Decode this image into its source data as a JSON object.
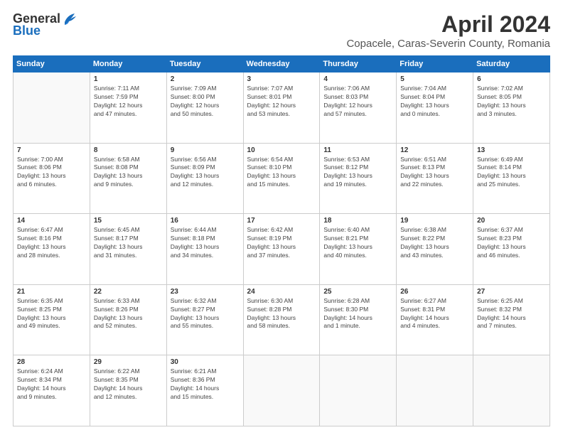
{
  "logo": {
    "text_general": "General",
    "text_blue": "Blue"
  },
  "title": "April 2024",
  "subtitle": "Copacele, Caras-Severin County, Romania",
  "calendar": {
    "headers": [
      "Sunday",
      "Monday",
      "Tuesday",
      "Wednesday",
      "Thursday",
      "Friday",
      "Saturday"
    ],
    "weeks": [
      [
        {
          "day": "",
          "info": ""
        },
        {
          "day": "1",
          "info": "Sunrise: 7:11 AM\nSunset: 7:59 PM\nDaylight: 12 hours\nand 47 minutes."
        },
        {
          "day": "2",
          "info": "Sunrise: 7:09 AM\nSunset: 8:00 PM\nDaylight: 12 hours\nand 50 minutes."
        },
        {
          "day": "3",
          "info": "Sunrise: 7:07 AM\nSunset: 8:01 PM\nDaylight: 12 hours\nand 53 minutes."
        },
        {
          "day": "4",
          "info": "Sunrise: 7:06 AM\nSunset: 8:03 PM\nDaylight: 12 hours\nand 57 minutes."
        },
        {
          "day": "5",
          "info": "Sunrise: 7:04 AM\nSunset: 8:04 PM\nDaylight: 13 hours\nand 0 minutes."
        },
        {
          "day": "6",
          "info": "Sunrise: 7:02 AM\nSunset: 8:05 PM\nDaylight: 13 hours\nand 3 minutes."
        }
      ],
      [
        {
          "day": "7",
          "info": "Sunrise: 7:00 AM\nSunset: 8:06 PM\nDaylight: 13 hours\nand 6 minutes."
        },
        {
          "day": "8",
          "info": "Sunrise: 6:58 AM\nSunset: 8:08 PM\nDaylight: 13 hours\nand 9 minutes."
        },
        {
          "day": "9",
          "info": "Sunrise: 6:56 AM\nSunset: 8:09 PM\nDaylight: 13 hours\nand 12 minutes."
        },
        {
          "day": "10",
          "info": "Sunrise: 6:54 AM\nSunset: 8:10 PM\nDaylight: 13 hours\nand 15 minutes."
        },
        {
          "day": "11",
          "info": "Sunrise: 6:53 AM\nSunset: 8:12 PM\nDaylight: 13 hours\nand 19 minutes."
        },
        {
          "day": "12",
          "info": "Sunrise: 6:51 AM\nSunset: 8:13 PM\nDaylight: 13 hours\nand 22 minutes."
        },
        {
          "day": "13",
          "info": "Sunrise: 6:49 AM\nSunset: 8:14 PM\nDaylight: 13 hours\nand 25 minutes."
        }
      ],
      [
        {
          "day": "14",
          "info": "Sunrise: 6:47 AM\nSunset: 8:16 PM\nDaylight: 13 hours\nand 28 minutes."
        },
        {
          "day": "15",
          "info": "Sunrise: 6:45 AM\nSunset: 8:17 PM\nDaylight: 13 hours\nand 31 minutes."
        },
        {
          "day": "16",
          "info": "Sunrise: 6:44 AM\nSunset: 8:18 PM\nDaylight: 13 hours\nand 34 minutes."
        },
        {
          "day": "17",
          "info": "Sunrise: 6:42 AM\nSunset: 8:19 PM\nDaylight: 13 hours\nand 37 minutes."
        },
        {
          "day": "18",
          "info": "Sunrise: 6:40 AM\nSunset: 8:21 PM\nDaylight: 13 hours\nand 40 minutes."
        },
        {
          "day": "19",
          "info": "Sunrise: 6:38 AM\nSunset: 8:22 PM\nDaylight: 13 hours\nand 43 minutes."
        },
        {
          "day": "20",
          "info": "Sunrise: 6:37 AM\nSunset: 8:23 PM\nDaylight: 13 hours\nand 46 minutes."
        }
      ],
      [
        {
          "day": "21",
          "info": "Sunrise: 6:35 AM\nSunset: 8:25 PM\nDaylight: 13 hours\nand 49 minutes."
        },
        {
          "day": "22",
          "info": "Sunrise: 6:33 AM\nSunset: 8:26 PM\nDaylight: 13 hours\nand 52 minutes."
        },
        {
          "day": "23",
          "info": "Sunrise: 6:32 AM\nSunset: 8:27 PM\nDaylight: 13 hours\nand 55 minutes."
        },
        {
          "day": "24",
          "info": "Sunrise: 6:30 AM\nSunset: 8:28 PM\nDaylight: 13 hours\nand 58 minutes."
        },
        {
          "day": "25",
          "info": "Sunrise: 6:28 AM\nSunset: 8:30 PM\nDaylight: 14 hours\nand 1 minute."
        },
        {
          "day": "26",
          "info": "Sunrise: 6:27 AM\nSunset: 8:31 PM\nDaylight: 14 hours\nand 4 minutes."
        },
        {
          "day": "27",
          "info": "Sunrise: 6:25 AM\nSunset: 8:32 PM\nDaylight: 14 hours\nand 7 minutes."
        }
      ],
      [
        {
          "day": "28",
          "info": "Sunrise: 6:24 AM\nSunset: 8:34 PM\nDaylight: 14 hours\nand 9 minutes."
        },
        {
          "day": "29",
          "info": "Sunrise: 6:22 AM\nSunset: 8:35 PM\nDaylight: 14 hours\nand 12 minutes."
        },
        {
          "day": "30",
          "info": "Sunrise: 6:21 AM\nSunset: 8:36 PM\nDaylight: 14 hours\nand 15 minutes."
        },
        {
          "day": "",
          "info": ""
        },
        {
          "day": "",
          "info": ""
        },
        {
          "day": "",
          "info": ""
        },
        {
          "day": "",
          "info": ""
        }
      ]
    ]
  }
}
